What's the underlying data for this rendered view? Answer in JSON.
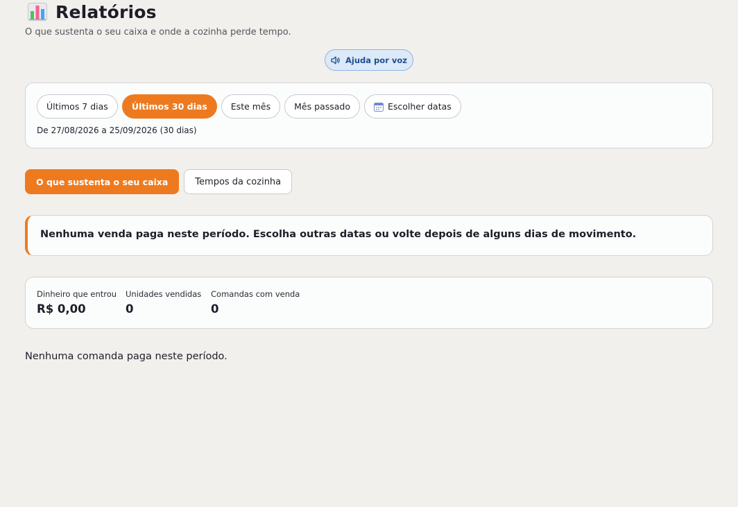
{
  "header": {
    "title": "Relatórios",
    "title_icon": "bar-chart-icon",
    "subtitle": "O que sustenta o seu caixa e onde a cozinha perde tempo."
  },
  "voice_help": {
    "label": "Ajuda por voz",
    "icon": "speaker-icon"
  },
  "period": {
    "options": [
      {
        "label": "Últimos 7 dias",
        "active": false
      },
      {
        "label": "Últimos 30 dias",
        "active": true
      },
      {
        "label": "Este mês",
        "active": false
      },
      {
        "label": "Mês passado",
        "active": false
      },
      {
        "label": "Escolher datas",
        "active": false,
        "icon": "calendar-icon"
      }
    ],
    "range_text": "De 27/08/2026 a 25/09/2026 (30 dias)"
  },
  "tabs": [
    {
      "label": "O que sustenta o seu caixa",
      "active": true
    },
    {
      "label": "Tempos da cozinha",
      "active": false
    }
  ],
  "alert": {
    "message": "Nenhuma venda paga neste período. Escolha outras datas ou volte depois de alguns dias de movimento."
  },
  "stats": [
    {
      "label": "Dinheiro que entrou",
      "value": "R$ 0,00"
    },
    {
      "label": "Unidades vendidas",
      "value": "0"
    },
    {
      "label": "Comandas com venda",
      "value": "0"
    }
  ],
  "empty_message": "Nenhuma comanda paga neste período.",
  "colors": {
    "accent": "#ee7a1f",
    "background": "#f2f0ec",
    "voice_button_bg": "#dce9f8",
    "voice_button_text": "#1f4f8f"
  }
}
